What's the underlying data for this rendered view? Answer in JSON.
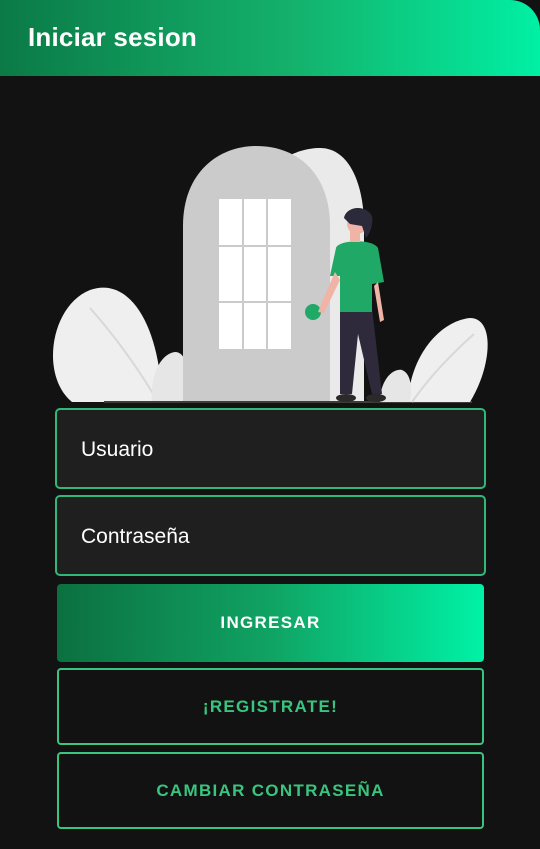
{
  "app_bar": {
    "title": "Iniciar sesion"
  },
  "illustration": {
    "name": "person-entering-door"
  },
  "form": {
    "username_placeholder": "Usuario",
    "password_placeholder": "Contraseña"
  },
  "actions": {
    "login_label": "INGRESAR",
    "register_label": "¡REGISTRATE!",
    "change_password_label": "CAMBIAR CONTRASEÑA"
  },
  "colors": {
    "background": "#121212",
    "accent_green": "#39c57f",
    "gradient_start": "#0b7a46",
    "gradient_end": "#00f0a4",
    "field_background": "#1f1f1f"
  }
}
